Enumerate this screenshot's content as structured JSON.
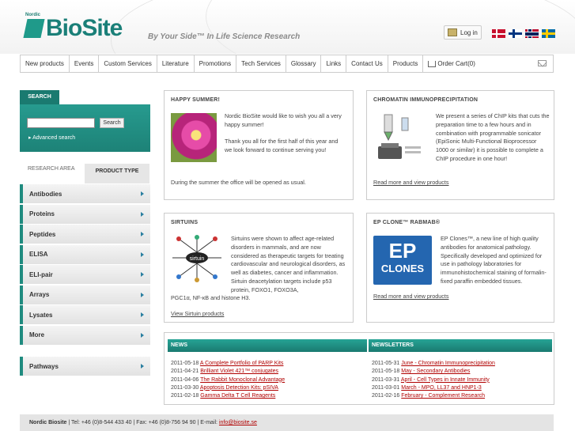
{
  "header": {
    "logo_small": "Nordic",
    "logo_text": "BioSite",
    "tagline": "By Your Side™ In Life Science Research",
    "login_label": "Log in",
    "flags": [
      "flag-dk-icon",
      "flag-fi-icon",
      "flag-no-icon",
      "flag-se-icon"
    ]
  },
  "nav": {
    "items": [
      "New products",
      "Events",
      "Custom Services",
      "Literature",
      "Promotions",
      "Tech Services",
      "Glossary",
      "Links",
      "Contact Us",
      "Products"
    ],
    "cart_label": "Order Cart(0)"
  },
  "search": {
    "tab_label": "SEARCH",
    "button_label": "Search",
    "advanced_label": "Advanced search"
  },
  "tabs": {
    "research_area": "RESEARCH AREA",
    "product_type": "PRODUCT TYPE"
  },
  "sidebar": {
    "items": [
      "Antibodies",
      "Proteins",
      "Peptides",
      "ELISA",
      "ELI-pair",
      "Arrays",
      "Lysates",
      "More"
    ],
    "pathways": "Pathways"
  },
  "panels": {
    "happy": {
      "title": "HAPPY SUMMER!",
      "p1": "Nordic BioSite would like to wish you all a very happy summer!",
      "p2": "Thank you all for the first half of this year and we look forward to continue serving you!",
      "p3": "During the summer the office will be opened as usual."
    },
    "chip": {
      "title": "CHROMATIN IMMUNOPRECIPITATION",
      "text": "We present a series of ChIP kits that cuts the preparation time to a few hours and in combination with programmable sonicator (EpiSonic Multi-Functional Bioprocessor 1000 or similar) it is possible to complete a ChIP procedure in one hour!",
      "link": "Read more and view products"
    },
    "sirtuins": {
      "title": "SIRTUINS",
      "text": "Sirtuins were shown to affect age-related disorders in mammals, and are now considered as therapeutic targets for treating cardiovascular and neurological disorders, as well as diabetes, cancer and inflammation. Sirtuin deacetylation targets include p53 protein, FOXO1, FOXO3A,",
      "text2": "PGC1α, NF-κB and histone H3.",
      "link": "View Sirtuin products",
      "image_center": "sirtuin"
    },
    "ep": {
      "title": "EP CLONE™ RABMAB®",
      "text": "EP Clones™, a new line of high quality antibodies for anatomical pathology. Specifically developed and optimized for use in pathology laboratories for immunohistochemical staining of formalin-fixed paraffin embedded tissues.",
      "link": "Read more and view products",
      "logo_line1": "EP",
      "logo_line2": "CLONES"
    }
  },
  "news": {
    "title": "NEWS",
    "items": [
      {
        "date": "2011-05-18",
        "text": "A Complete Portfolio of PARP Kits"
      },
      {
        "date": "2011-04-21",
        "text": "Brilliant Violet 421™ conjugates"
      },
      {
        "date": "2011-04-06",
        "text": "The Rabbit Monoclonal Advantage"
      },
      {
        "date": "2011-03-30",
        "text": "Apoptosis Detection Kits: pSIVA"
      },
      {
        "date": "2011-02-18",
        "text": "Gamma Delta T Cell Reagents"
      }
    ]
  },
  "newsletters": {
    "title": "NEWSLETTERS",
    "items": [
      {
        "date": "2011-05-31",
        "text": "June - Chromatin Immunoprecipitation"
      },
      {
        "date": "2011-05-18",
        "text": "May - Secondary Antibodies"
      },
      {
        "date": "2011-03-31",
        "text": "April - Cell Types in Innate Immunity"
      },
      {
        "date": "2011-03-01",
        "text": "March - MPO, LL37 and HNP1-3"
      },
      {
        "date": "2011-02-16",
        "text": "February - Complement Research"
      }
    ]
  },
  "footer": {
    "company": "Nordic Biosite",
    "contact": " | Tel: +46 (0)8-544 433 40 | Fax: +46 (0)8-756 94 90 | E-mail: ",
    "email": "info@biosite.se"
  }
}
